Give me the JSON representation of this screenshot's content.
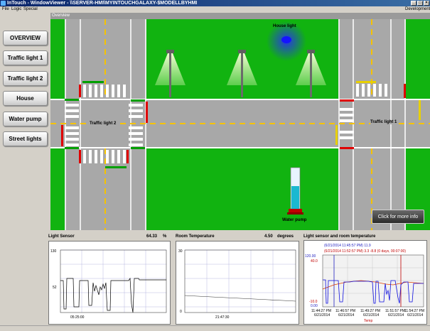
{
  "window": {
    "title": "InTouch - WindowViewer - \\\\SERVER-HMI\\MYINTOUCHGALAXY-$MODELLBYHMI",
    "mode": "Development"
  },
  "menu": [
    "File",
    "Logic",
    "Special"
  ],
  "nav": {
    "buttons": [
      "OVERVIEW",
      "Traffic light 1",
      "Traffic light 2",
      "House",
      "Water pump",
      "Street lights"
    ]
  },
  "scene": {
    "header": "Overview",
    "house_light_label": "House light",
    "traffic_light_2_label": "Traffic light 2",
    "traffic_light_1_label": "Traffic light 1",
    "water_pump_label": "Water pump",
    "more_info_button": "Click for more info",
    "colors": {
      "grass": "#11b310",
      "road": "#a8a8a8",
      "lane_dash": "#f5c300",
      "signal_red": "#e00000",
      "signal_green": "#00a000",
      "signal_yellow": "#e8d000"
    }
  },
  "light_sensor": {
    "title": "Light Sensor",
    "value": "64.33",
    "unit": "%",
    "y_ticks": [
      "130",
      "52"
    ],
    "x_tick": "05:25:00"
  },
  "room_temperature": {
    "title": "Room Temperature",
    "value": "4.50",
    "unit": "degrees",
    "y_ticks": [
      "30",
      "0"
    ],
    "x_tick": "21:47:30"
  },
  "combined": {
    "title": "Light sensor and room temperature",
    "legend_1": "(6/21/2014 11:45:57 PM) 11.9",
    "legend_2": "(6/21/2014 11:52:57 PM) 3.3  -8.8  (0 days, 00:07:00)",
    "y_left_ticks": [
      "120.00",
      "40.0",
      "-10.0",
      "0.00"
    ],
    "x_ticks": [
      {
        "time": "11:44:27 PM",
        "date": "6/21/2014"
      },
      {
        "time": "11:46:57 PM",
        "date": "6/21/2014"
      },
      {
        "time": "11:49:27 PM",
        "date": "6/21/2014"
      },
      {
        "time": "11:51:57 PM",
        "date": "6/21/2014"
      },
      {
        "time": "11:54:27 PM",
        "date": "6/21/2014"
      }
    ],
    "x_axis_label": "Temp"
  }
}
